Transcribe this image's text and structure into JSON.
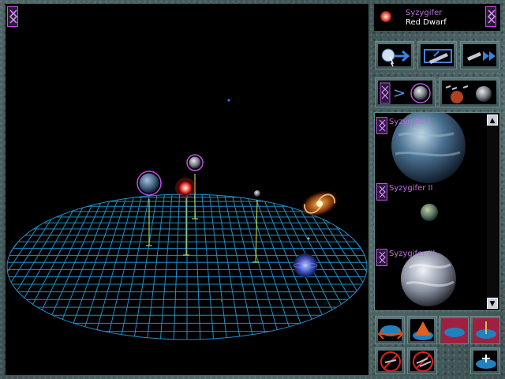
{
  "star": {
    "name": "Syzygifer",
    "type": "Red Dwarf",
    "icon": "red-star-icon"
  },
  "planets": [
    {
      "label": "Syzygifer I"
    },
    {
      "label": "Syzygifer II"
    },
    {
      "label": "Syzygifer III"
    }
  ],
  "scroll": {
    "up": "▲",
    "down": "▼"
  },
  "colors": {
    "grid": "#1f8ec8",
    "accent": "#c050e0",
    "label": "#c070e0",
    "stem": "#d8f060"
  },
  "icons": {
    "top_tools": [
      "clock-arrow-icon",
      "ship-launch-icon",
      "ship-fleet-icon"
    ],
    "mid_tools": [
      "planet-route-icon",
      "fleet-planets-icon"
    ],
    "bottom_tools": [
      "grid-arrows-icon",
      "grid-pyramid-icon",
      "grid-flat-icon",
      "grid-axis-icon",
      "no-route-icon",
      "no-fleet-icon",
      "grid-plus-icon"
    ]
  }
}
